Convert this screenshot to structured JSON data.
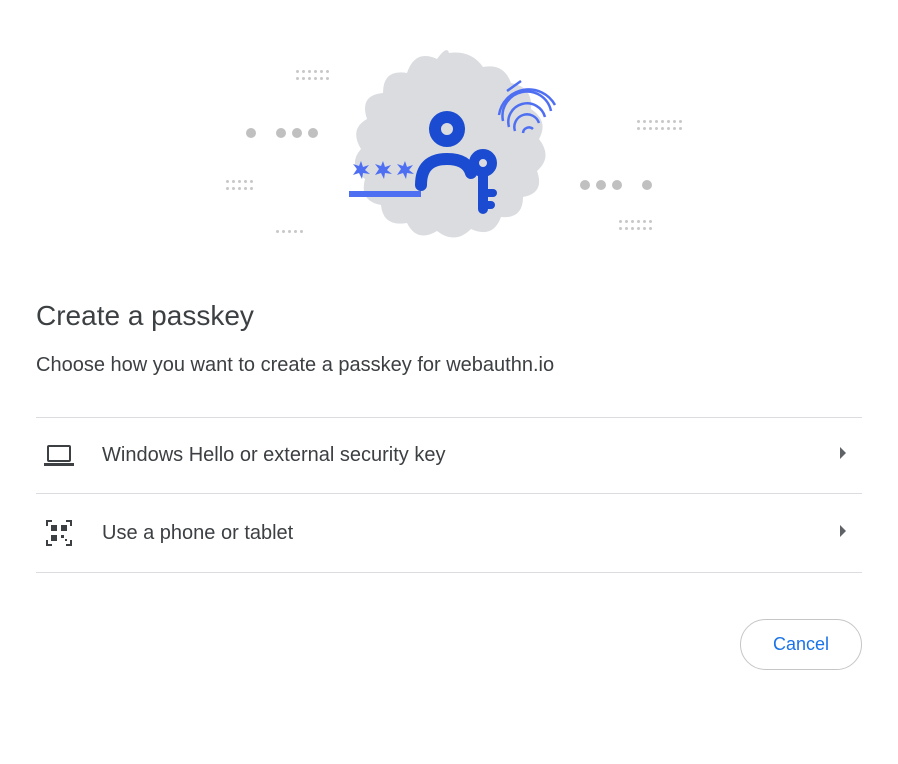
{
  "heading": "Create a passkey",
  "description": "Choose how you want to create a passkey for webauthn.io",
  "options": [
    {
      "label": "Windows Hello or external security key"
    },
    {
      "label": "Use a phone or tablet"
    }
  ],
  "buttons": {
    "cancel": "Cancel"
  }
}
